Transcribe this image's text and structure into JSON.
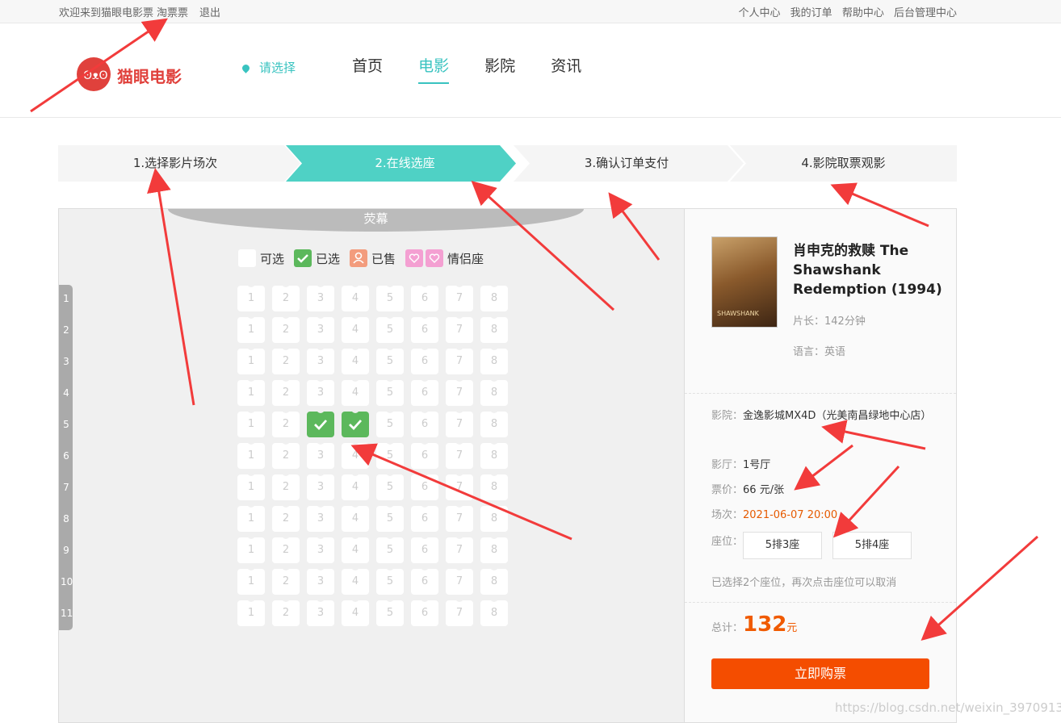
{
  "topbar": {
    "welcome": "欢迎来到猫眼电影票",
    "username": "淘票票",
    "logout": "退出",
    "links": [
      "个人中心",
      "我的订单",
      "帮助中心",
      "后台管理中心"
    ]
  },
  "header": {
    "logo_text": "猫眼电影",
    "city": "请选择",
    "nav": [
      "首页",
      "电影",
      "影院",
      "资讯"
    ],
    "active_nav": "电影"
  },
  "steps": [
    "1.选择影片场次",
    "2.在线选座",
    "3.确认订单支付",
    "4.影院取票观影"
  ],
  "active_step": 1,
  "seating": {
    "screen_label": "荧幕",
    "legend": {
      "available": "可选",
      "selected": "已选",
      "sold": "已售",
      "couple": "情侣座"
    },
    "rows": [
      "1",
      "2",
      "3",
      "4",
      "5",
      "6",
      "7",
      "8",
      "9",
      "10",
      "11"
    ],
    "cols": [
      "1",
      "2",
      "3",
      "4",
      "5",
      "6",
      "7",
      "8"
    ],
    "selected_seats": [
      [
        5,
        3
      ],
      [
        5,
        4
      ]
    ]
  },
  "movie": {
    "title": "肖申克的救赎 The Shawshank Redemption (1994)",
    "duration_label": "片长：",
    "duration": "142分钟",
    "language_label": "语言：",
    "language": "英语"
  },
  "order": {
    "cinema_label": "影院：",
    "cinema": "金逸影城MX4D（光美南昌绿地中心店）",
    "hall_label": "影厅：",
    "hall": "1号厅",
    "price_label": "票价：",
    "price": "66 元/张",
    "time_label": "场次：",
    "time": "2021-06-07 20:00",
    "seats_label": "座位：",
    "seats": [
      "5排3座",
      "5排4座"
    ],
    "hint": "已选择2个座位，再次点击座位可以取消",
    "total_label": "总计：",
    "total": "132",
    "total_unit": "元",
    "buy_button": "立即购票"
  },
  "watermark": "https://blog.csdn.net/weixin_39709134",
  "colors": {
    "teal": "#39c3c0",
    "step_active": "#4fd1c5",
    "selected_seat": "#5cb85c",
    "buy_button": "#f44d00",
    "annotation_red": "#f23b3b"
  }
}
